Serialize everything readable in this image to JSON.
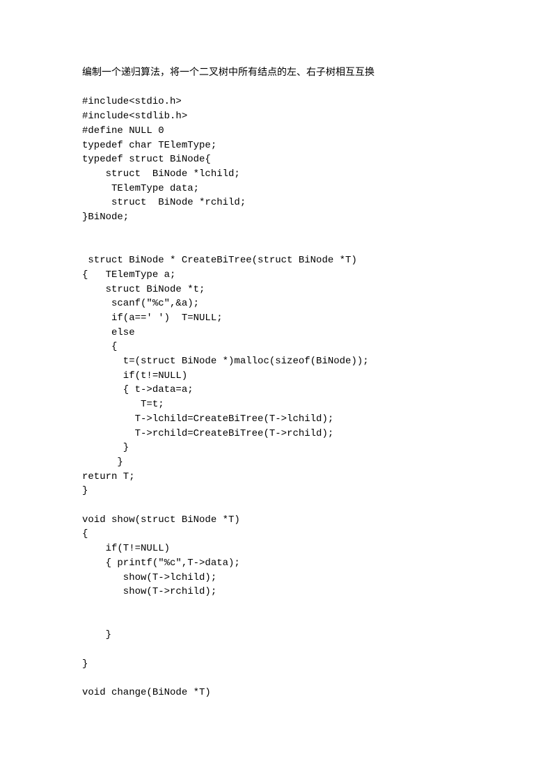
{
  "lines": [
    "编制一个递归算法，将一个二叉树中所有结点的左、右子树相互互换",
    "",
    "#include<stdio.h>",
    "#include<stdlib.h>",
    "#define NULL 0",
    "typedef char TElemType;",
    "typedef struct BiNode{",
    "    struct  BiNode *lchild;",
    "     TElemType data;",
    "     struct  BiNode *rchild;",
    "}BiNode;",
    "",
    "",
    " struct BiNode * CreateBiTree(struct BiNode *T)",
    "{   TElemType a;",
    "    struct BiNode *t;",
    "     scanf(\"%c\",&a);",
    "     if(a==' ')  T=NULL;",
    "     else",
    "     {",
    "       t=(struct BiNode *)malloc(sizeof(BiNode));",
    "       if(t!=NULL)",
    "       { t->data=a;",
    "          T=t;",
    "         T->lchild=CreateBiTree(T->lchild);",
    "         T->rchild=CreateBiTree(T->rchild);",
    "       }",
    "      }",
    "return T;",
    "}",
    "",
    "void show(struct BiNode *T)",
    "{",
    "    if(T!=NULL)",
    "    { printf(\"%c\",T->data);",
    "       show(T->lchild);",
    "       show(T->rchild);",
    "",
    "",
    "    }",
    "",
    "}",
    "",
    "void change(BiNode *T)"
  ]
}
